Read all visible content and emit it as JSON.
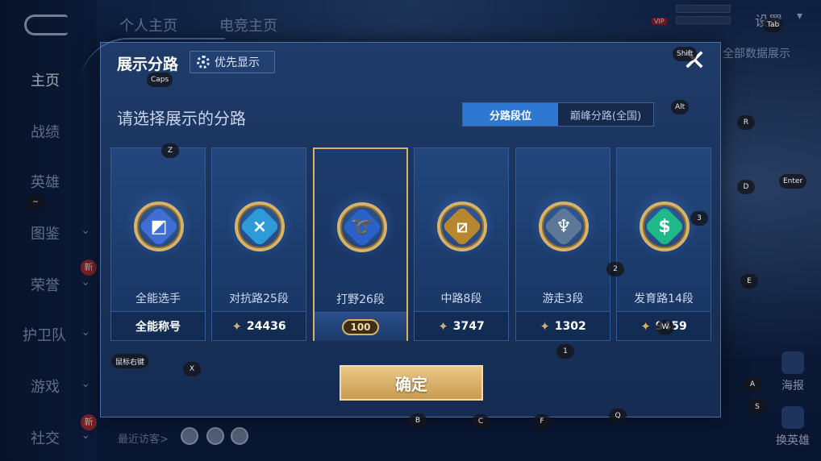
{
  "background": {
    "top_tabs": [
      "个人主页",
      "电竞主页"
    ],
    "settings_label": "设置",
    "vip_label": "VIP",
    "right_label": "全部数据展示",
    "recent_visitors_label": "最近访客>",
    "right_buttons": [
      "海报",
      "换英雄"
    ]
  },
  "sidebar": {
    "items": [
      {
        "label": "主页",
        "active": true
      },
      {
        "label": "战绩"
      },
      {
        "label": "英雄"
      },
      {
        "label": "图鉴",
        "chevron": true
      },
      {
        "label": "荣誉",
        "chevron": true,
        "badge": "新"
      },
      {
        "label": "护卫队",
        "chevron": true
      },
      {
        "label": "游戏",
        "chevron": true
      },
      {
        "label": "社交",
        "chevron": true,
        "badge": "新"
      }
    ]
  },
  "modal": {
    "title": "展示分路",
    "priority_button": "优先显示",
    "close_icon": "✕",
    "subtitle": "请选择展示的分路",
    "segment": {
      "options": [
        "分路段位",
        "巅峰分路(全国)"
      ],
      "selected": 0
    },
    "cards": [
      {
        "label": "全能选手",
        "value": "全能称号",
        "has_star": false,
        "emblem_color": "#3f6fd6",
        "symbol": "◩",
        "selected": false
      },
      {
        "label": "对抗路25段",
        "value": "24436",
        "has_star": true,
        "emblem_color": "#2d9bd9",
        "symbol": "⨯",
        "selected": false
      },
      {
        "label": "打野26段",
        "value": "100",
        "has_star": false,
        "emblem_color": "#2a62c9",
        "symbol": "➰",
        "selected": true
      },
      {
        "label": "中路8段",
        "value": "3747",
        "has_star": true,
        "emblem_color": "#b8862f",
        "symbol": "⧄",
        "selected": false
      },
      {
        "label": "游走3段",
        "value": "1302",
        "has_star": true,
        "emblem_color": "#5d7796",
        "symbol": "♆",
        "selected": false
      },
      {
        "label": "发育路14段",
        "value": "9459",
        "has_star": true,
        "emblem_color": "#1fb889",
        "symbol": "$",
        "selected": false
      }
    ],
    "confirm_button": "确定"
  },
  "key_hints": [
    "Tab",
    "Shift",
    "Caps",
    "Alt",
    "Z",
    "R",
    "D",
    "Enter",
    "~",
    "3",
    "2",
    "E",
    "W",
    "1",
    "鼠标右键",
    "X",
    "A",
    "S",
    "B",
    "C",
    "F",
    "Q"
  ]
}
